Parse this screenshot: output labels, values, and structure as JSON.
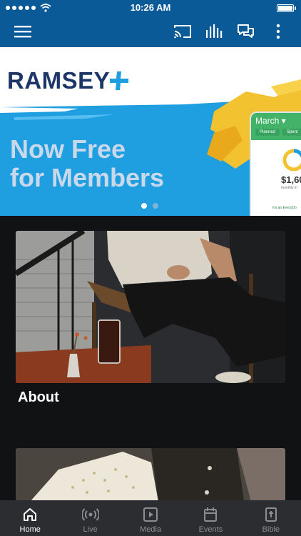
{
  "status_bar": {
    "time": "10:26 AM"
  },
  "app_bar": {
    "icons": [
      "menu-icon",
      "cast-icon",
      "equalizer-icon",
      "chat-icon",
      "more-vertical-icon"
    ]
  },
  "banner": {
    "brand": "RAMSEY",
    "headline_line1": "Now Free",
    "headline_line2": "for Members",
    "phone_month": "March",
    "phone_tab1": "Planned",
    "phone_tab2": "Spent",
    "phone_amount": "$1,60",
    "phone_sub": "monthly in",
    "phone_footer": "It's an EveryDo",
    "pager": {
      "count": 2,
      "active": 0
    }
  },
  "cards": [
    {
      "title": "About"
    },
    {
      "title": ""
    }
  ],
  "tabbar": {
    "items": [
      {
        "label": "Home",
        "icon": "home-icon",
        "active": true
      },
      {
        "label": "Live",
        "icon": "live-broadcast-icon",
        "active": false
      },
      {
        "label": "Media",
        "icon": "play-icon",
        "active": false
      },
      {
        "label": "Events",
        "icon": "calendar-icon",
        "active": false
      },
      {
        "label": "Bible",
        "icon": "bible-icon",
        "active": false
      }
    ]
  },
  "colors": {
    "primary": "#0b5a98",
    "brand_navy": "#1c3668",
    "banner_blue": "#1f9ee0",
    "accent_yellow": "#f2c230",
    "tab_active": "#ffffff",
    "tab_inactive": "#8a8d92"
  }
}
